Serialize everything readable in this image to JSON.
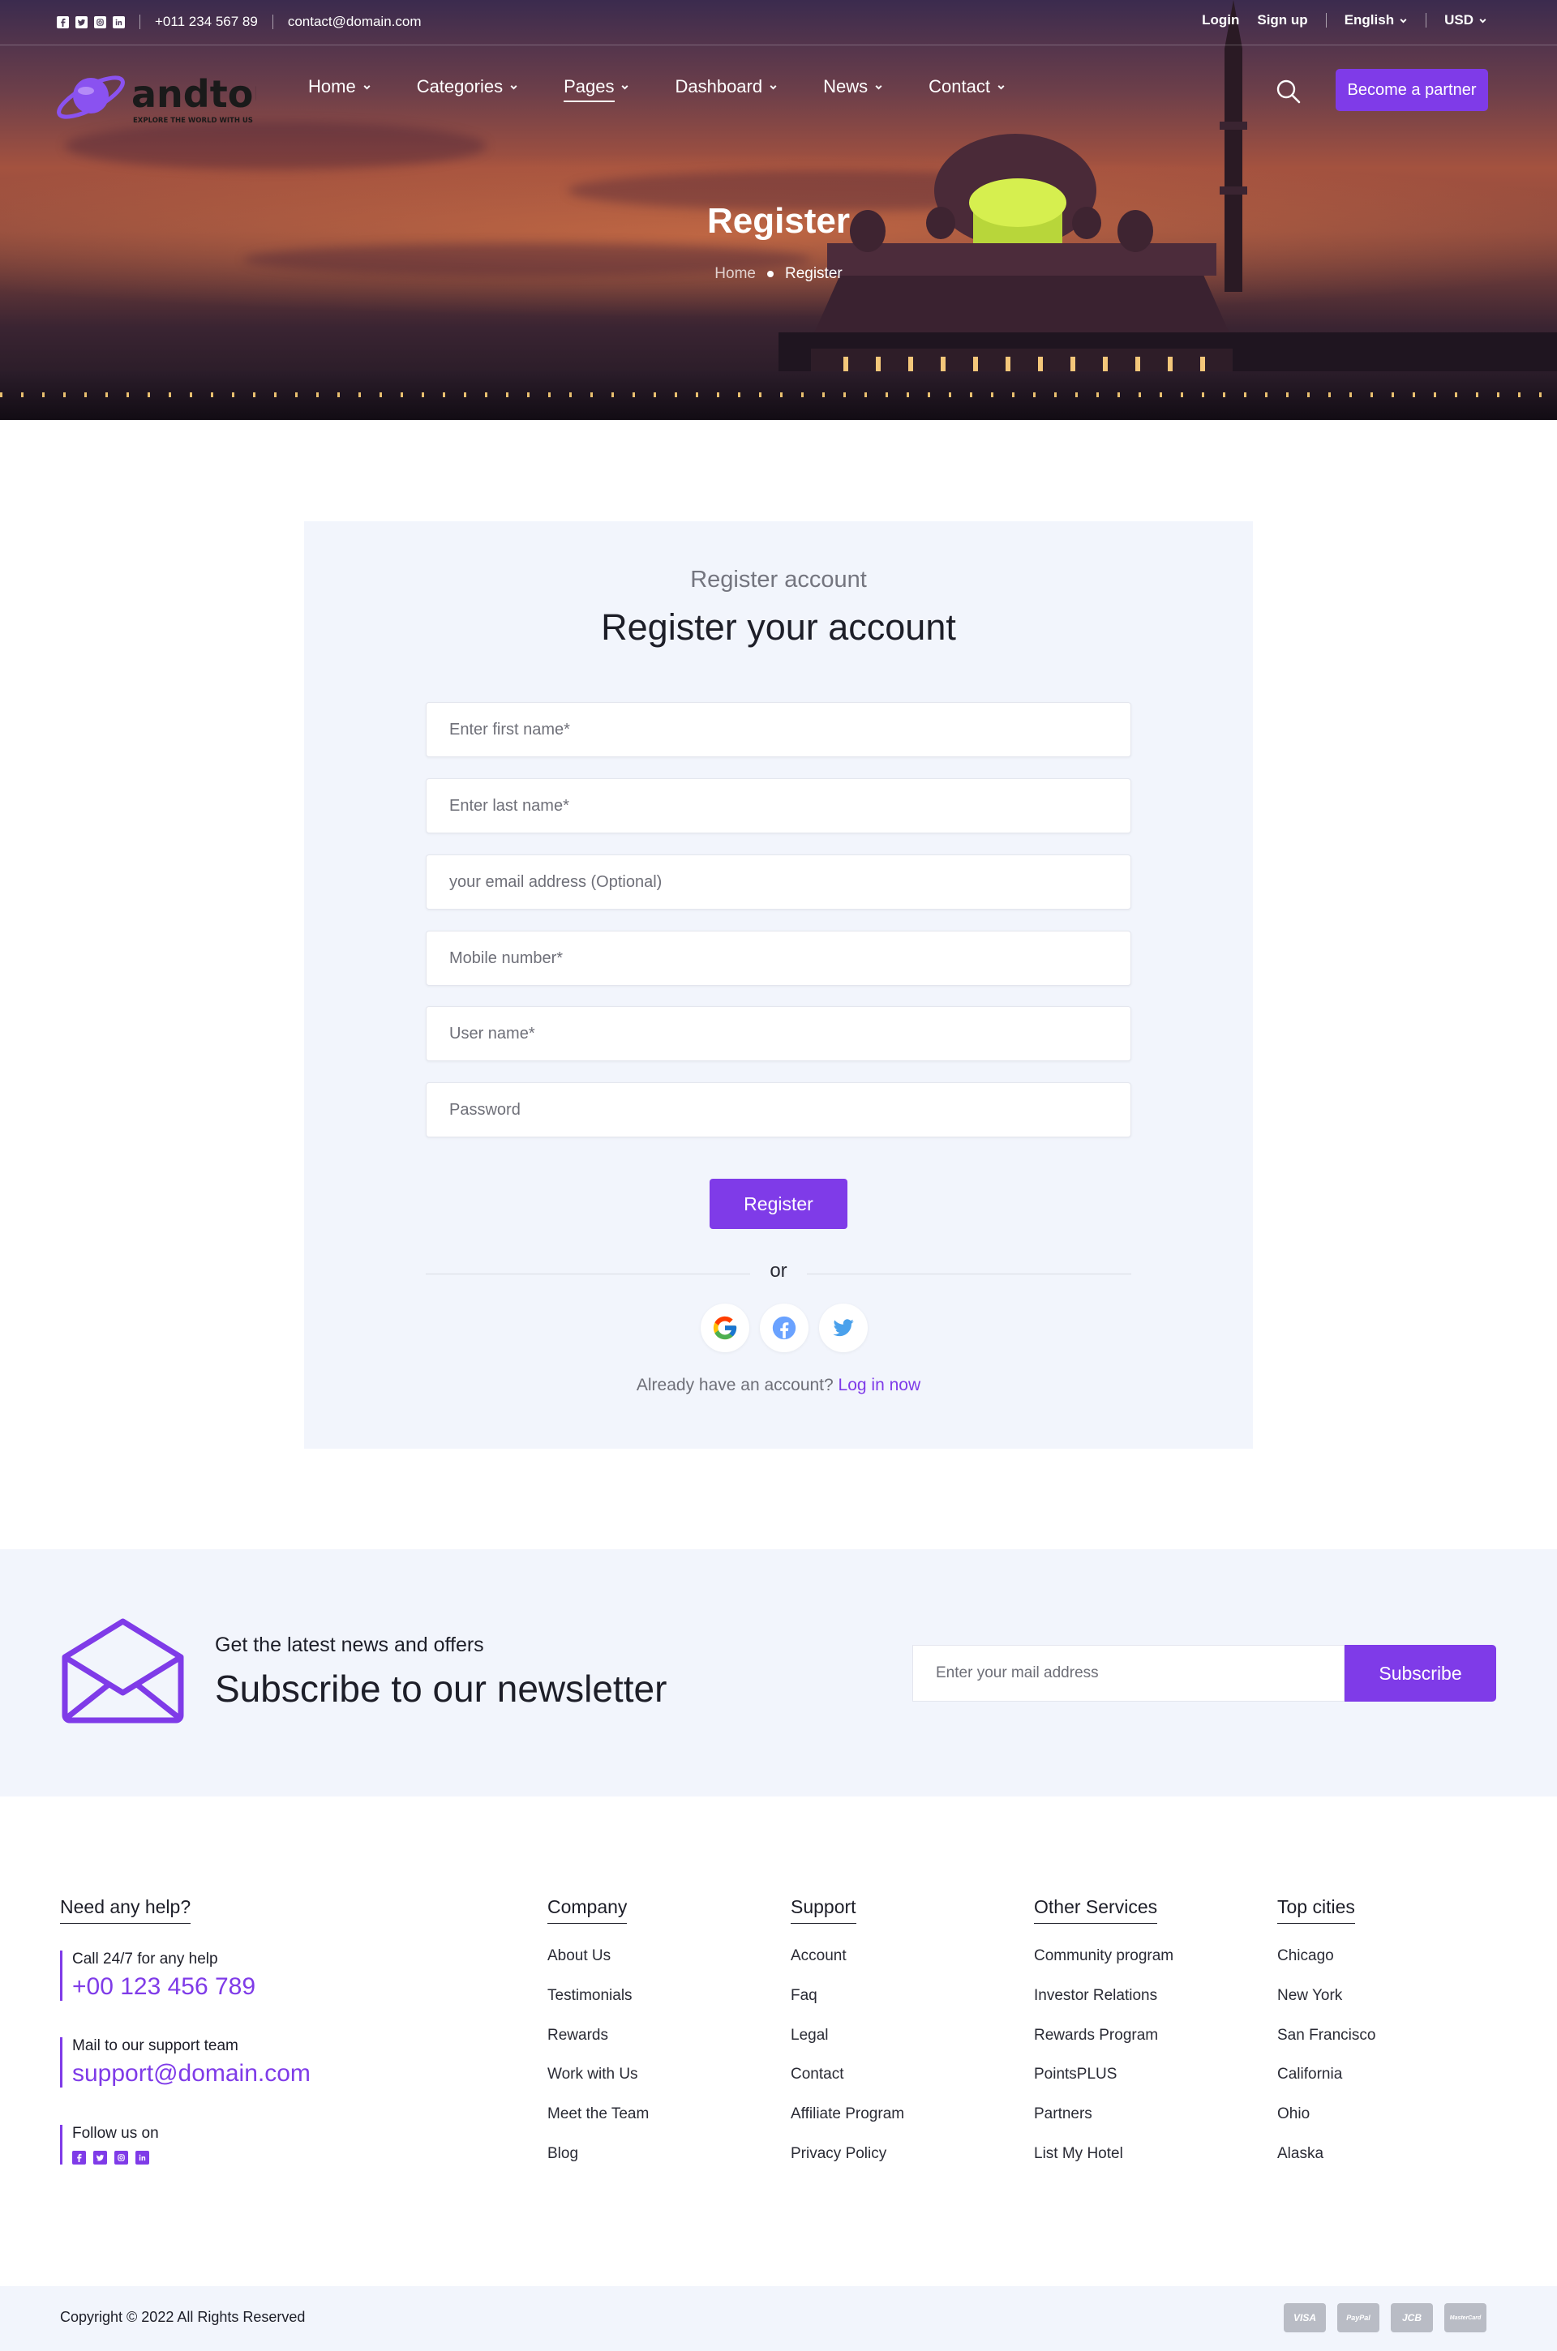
{
  "topbar": {
    "phone": "+011 234 567 89",
    "email": "contact@domain.com",
    "login": "Login",
    "signup": "Sign up",
    "language": "English",
    "currency": "USD"
  },
  "brand": {
    "name": "andtour",
    "tagline": "EXPLORE THE WORLD WITH US"
  },
  "nav": {
    "items": [
      {
        "label": "Home"
      },
      {
        "label": "Categories"
      },
      {
        "label": "Pages"
      },
      {
        "label": "Dashboard"
      },
      {
        "label": "News"
      },
      {
        "label": "Contact"
      }
    ],
    "partner_button": "Become a partner"
  },
  "hero": {
    "title": "Register",
    "breadcrumb": {
      "home": "Home",
      "current": "Register"
    }
  },
  "register": {
    "subtitle": "Register account",
    "title": "Register your account",
    "fields": {
      "first_name": {
        "placeholder": "Enter first name*",
        "value": ""
      },
      "last_name": {
        "placeholder": "Enter last name*",
        "value": ""
      },
      "email": {
        "placeholder": "your email address (Optional)",
        "value": ""
      },
      "mobile": {
        "placeholder": "Mobile number*",
        "value": ""
      },
      "username": {
        "placeholder": "User name*",
        "value": ""
      },
      "password": {
        "placeholder": "Password",
        "value": ""
      }
    },
    "submit": "Register",
    "divider": "or",
    "already_text": "Already have an account?",
    "login_link": "Log in now"
  },
  "newsletter": {
    "small": "Get the latest news and offers",
    "title": "Subscribe to our newsletter",
    "placeholder": "Enter your mail address",
    "button": "Subscribe"
  },
  "footer": {
    "help": {
      "title": "Need any help?",
      "call_label": "Call 24/7 for any help",
      "phone": "+00 123 456 789",
      "mail_label": "Mail to our support team",
      "mail": "support@domain.com",
      "follow": "Follow us on"
    },
    "columns": [
      {
        "title": "Company",
        "links": [
          "About Us",
          "Testimonials",
          "Rewards",
          "Work with Us",
          "Meet the Team",
          "Blog"
        ]
      },
      {
        "title": "Support",
        "links": [
          "Account",
          "Faq",
          "Legal",
          "Contact",
          "Affiliate Program",
          "Privacy Policy"
        ]
      },
      {
        "title": "Other Services",
        "links": [
          "Community program",
          "Investor Relations",
          "Rewards Program",
          "PointsPLUS",
          "Partners",
          "List My Hotel"
        ]
      },
      {
        "title": "Top cities",
        "links": [
          "Chicago",
          "New York",
          "San Francisco",
          "California",
          "Ohio",
          "Alaska"
        ]
      }
    ],
    "copyright": "Copyright © 2022 All Rights Reserved",
    "payment_cards": [
      "VISA",
      "PayPal",
      "JCB",
      "MasterCard"
    ]
  },
  "colors": {
    "accent": "#7f3be8",
    "panel": "#f2f5fc",
    "text": "#1d1e28"
  }
}
